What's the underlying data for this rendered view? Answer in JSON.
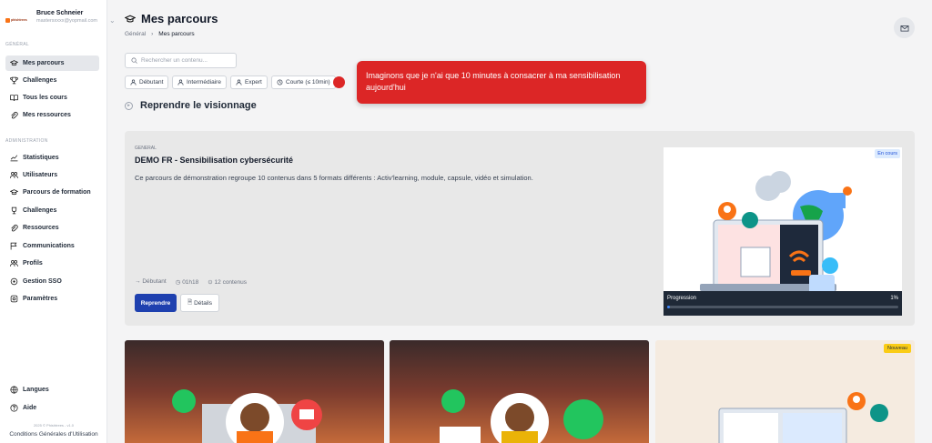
{
  "user": {
    "name": "Bruce Schneier",
    "email": "mastersxxxx@yopmail.com",
    "logo_text": "phishtrees"
  },
  "sidebar": {
    "section_general": "GÉNÉRAL",
    "section_admin": "ADMINISTRATION",
    "general_items": [
      {
        "label": "Mes parcours",
        "icon": "graduation-cap-icon"
      },
      {
        "label": "Challenges",
        "icon": "trophy-icon"
      },
      {
        "label": "Tous les cours",
        "icon": "book-icon"
      },
      {
        "label": "Mes ressources",
        "icon": "paperclip-icon"
      }
    ],
    "admin_items": [
      {
        "label": "Statistiques",
        "icon": "chart-icon"
      },
      {
        "label": "Utilisateurs",
        "icon": "users-icon"
      },
      {
        "label": "Parcours de formation",
        "icon": "graduation-cap-icon"
      },
      {
        "label": "Challenges",
        "icon": "trophy-icon"
      },
      {
        "label": "Ressources",
        "icon": "paperclip-icon"
      },
      {
        "label": "Communications",
        "icon": "flag-icon"
      },
      {
        "label": "Profils",
        "icon": "users-icon"
      },
      {
        "label": "Gestion SSO",
        "icon": "sso-icon"
      },
      {
        "label": "Paramètres",
        "icon": "settings-icon"
      }
    ],
    "langues": "Langues",
    "aide": "Aide",
    "copyright": "2025 © Phishtrees - v1.0",
    "cgu": "Conditions Générales d'Utilisation"
  },
  "header": {
    "title": "Mes parcours",
    "breadcrumb": [
      "Général",
      "Mes parcours"
    ]
  },
  "search": {
    "placeholder": "Rechercher un contenu..."
  },
  "filters": [
    "Débutant",
    "Intermédiaire",
    "Expert",
    "Courte (≤ 10min)"
  ],
  "tooltip": "Imaginons que je n'ai que 10 minutes à consacrer à ma sensibilisation aujourd'hui",
  "resume_title": "Reprendre le visionnage",
  "featured": {
    "category": "GENERAL",
    "title": "DEMO FR - Sensibilisation cybersécurité",
    "description": "Ce parcours de démonstration regroupe 10 contenus dans 5 formats différents : Activ'learning, module, capsule, vidéo et simulation.",
    "level": "Débutant",
    "duration": "01h18",
    "contents": "12 contenus",
    "status": "En cours",
    "progress_label": "Progression",
    "progress_text": "1%",
    "progress_value": 1,
    "resume_button": "Reprendre",
    "details_button": "Détails"
  },
  "bottom_cards": [
    {
      "badge": ""
    },
    {
      "badge": ""
    },
    {
      "badge": "Nouveau"
    }
  ],
  "colors": {
    "primary": "#1e40af",
    "accent": "#dc2626",
    "badge_new": "#facc15"
  }
}
